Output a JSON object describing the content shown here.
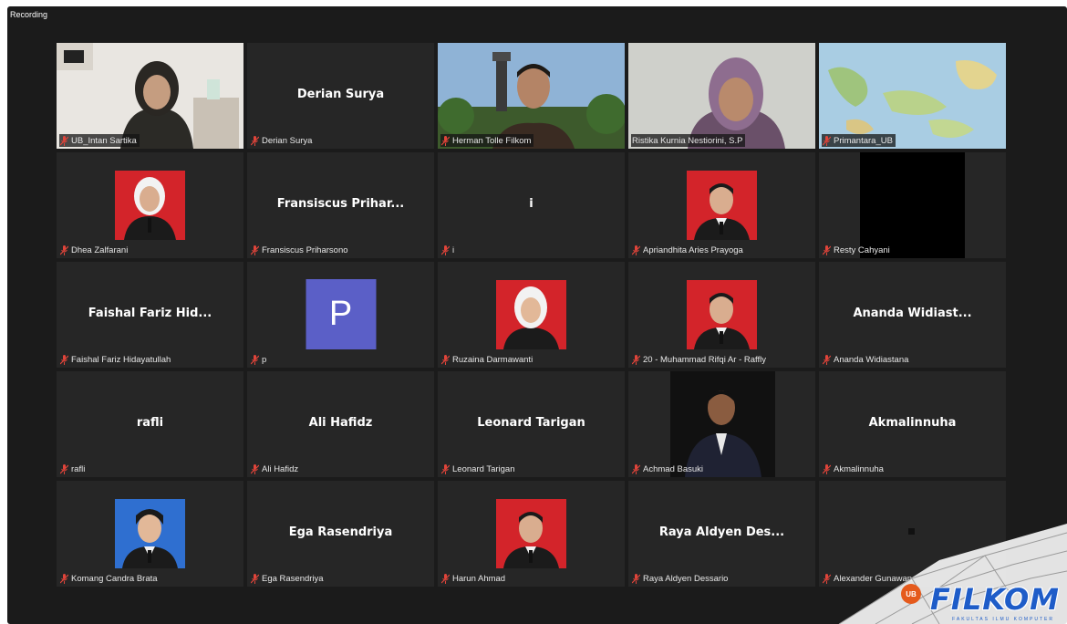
{
  "window": {
    "status_label": "Recording"
  },
  "tiles": [
    {
      "display_name": "",
      "label": "UB_Intan Sartika",
      "video": "person-hijab"
    },
    {
      "display_name": "Derian Surya",
      "label": "Derian Surya"
    },
    {
      "display_name": "",
      "label": "Herman Tolle Filkom",
      "video": "person-clocktower"
    },
    {
      "display_name": "",
      "label": "Ristika Kurnia Nestiorini, S.P",
      "video": "person-hijab-purple",
      "active": true
    },
    {
      "display_name": "",
      "label": "Primantara_UB",
      "video": "map"
    },
    {
      "display_name": "",
      "label": "Dhea Zalfarani",
      "video": "id-photo-red-hijab"
    },
    {
      "display_name": "Fransiscus Prihar...",
      "label": "Fransiscus Priharsono"
    },
    {
      "display_name": "i",
      "label": "i"
    },
    {
      "display_name": "",
      "label": "Apriandhita Aries Prayoga",
      "video": "id-photo-red"
    },
    {
      "display_name": "",
      "label": "Resty Cahyani",
      "video": "black"
    },
    {
      "display_name": "Faishal Fariz Hid...",
      "label": "Faishal Fariz Hidayatullah"
    },
    {
      "display_name": "",
      "label": "p",
      "avatar": "P"
    },
    {
      "display_name": "",
      "label": "Ruzaina Darmawanti",
      "video": "id-photo-red-hijab"
    },
    {
      "display_name": "",
      "label": "20 - Muhammad Rifqi Ar - Raffly",
      "video": "id-photo-red"
    },
    {
      "display_name": "Ananda Widiast...",
      "label": "Ananda Widiastana"
    },
    {
      "display_name": "rafli",
      "label": "rafli"
    },
    {
      "display_name": "Ali Hafidz",
      "label": "Ali Hafidz"
    },
    {
      "display_name": "Leonard Tarigan",
      "label": "Leonard Tarigan"
    },
    {
      "display_name": "",
      "label": "Achmad Basuki",
      "video": "person-suit"
    },
    {
      "display_name": "Akmalinnuha",
      "label": "Akmalinnuha"
    },
    {
      "display_name": "",
      "label": "Komang Candra Brata",
      "video": "id-photo-blue"
    },
    {
      "display_name": "Ega Rasendriya",
      "label": "Ega Rasendriya"
    },
    {
      "display_name": "",
      "label": "Harun Ahmad",
      "video": "id-photo-red"
    },
    {
      "display_name": "Raya Aldyen Des...",
      "label": "Raya Aldyen Dessario"
    },
    {
      "display_name": "",
      "label": "Alexander Gunawan",
      "video": "dot"
    }
  ],
  "logo": {
    "text": "FILKOM",
    "badge": "UB",
    "sub": "FAKULTAS ILMU KOMPUTER"
  },
  "colors": {
    "active_border": "#bedb4f",
    "mic_muted": "#e0443a",
    "avatar_bg": "#5b5fc7",
    "logo_blue": "#1e5cc8"
  }
}
